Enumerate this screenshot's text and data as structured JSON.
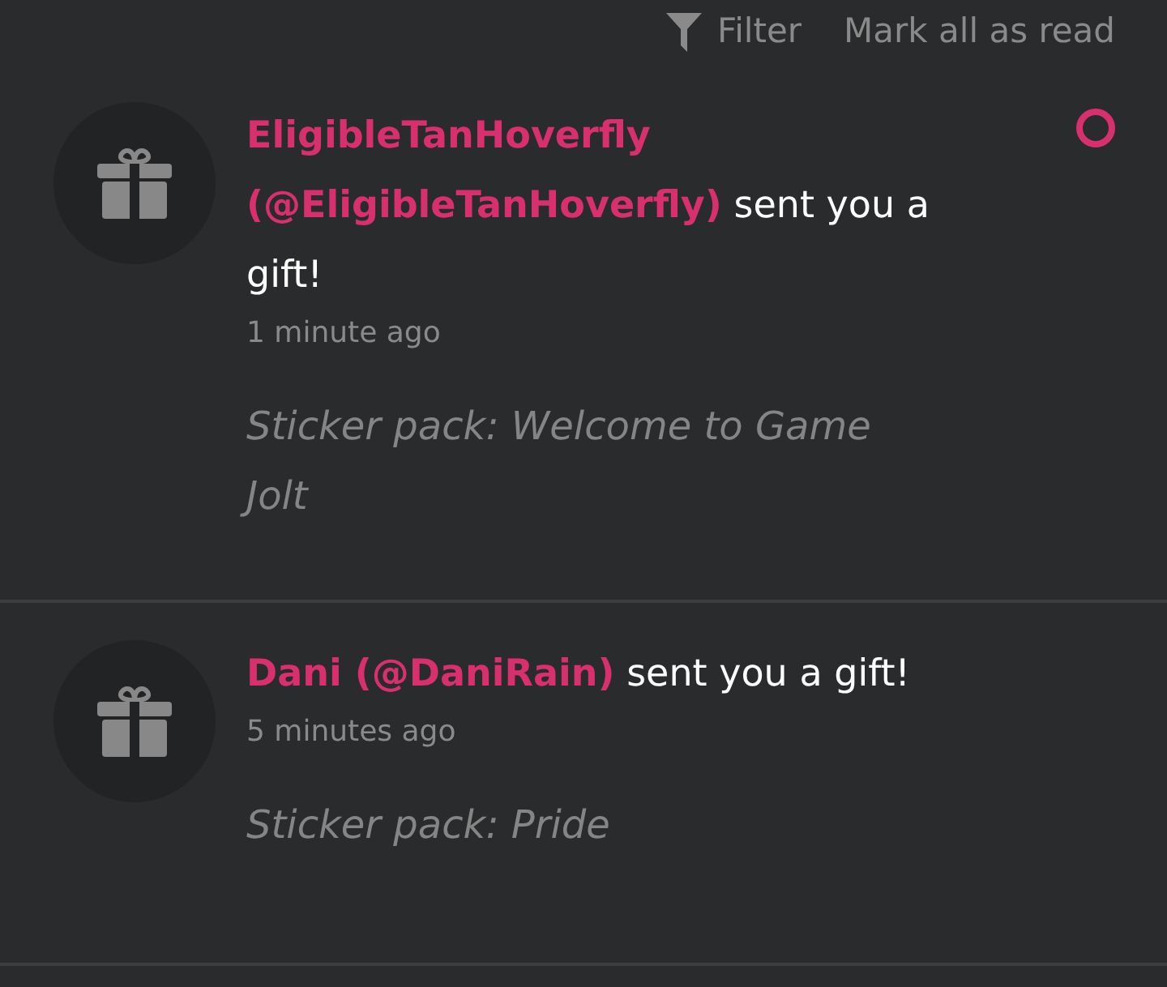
{
  "toolbar": {
    "filter": "Filter",
    "mark_all": "Mark all as read"
  },
  "notifications": [
    {
      "message": "**EligibleTanHoverfly (@EligibleTanHoverfly)** sent you a gift!",
      "time": "1 minute ago",
      "detail": "Sticker pack: Welcome to Game Jolt",
      "unread": true
    },
    {
      "message": "**Dani (@DaniRain)** sent you a gift!",
      "time": "5 minutes ago",
      "detail": "Sticker pack: Pride",
      "unread": false
    }
  ]
}
